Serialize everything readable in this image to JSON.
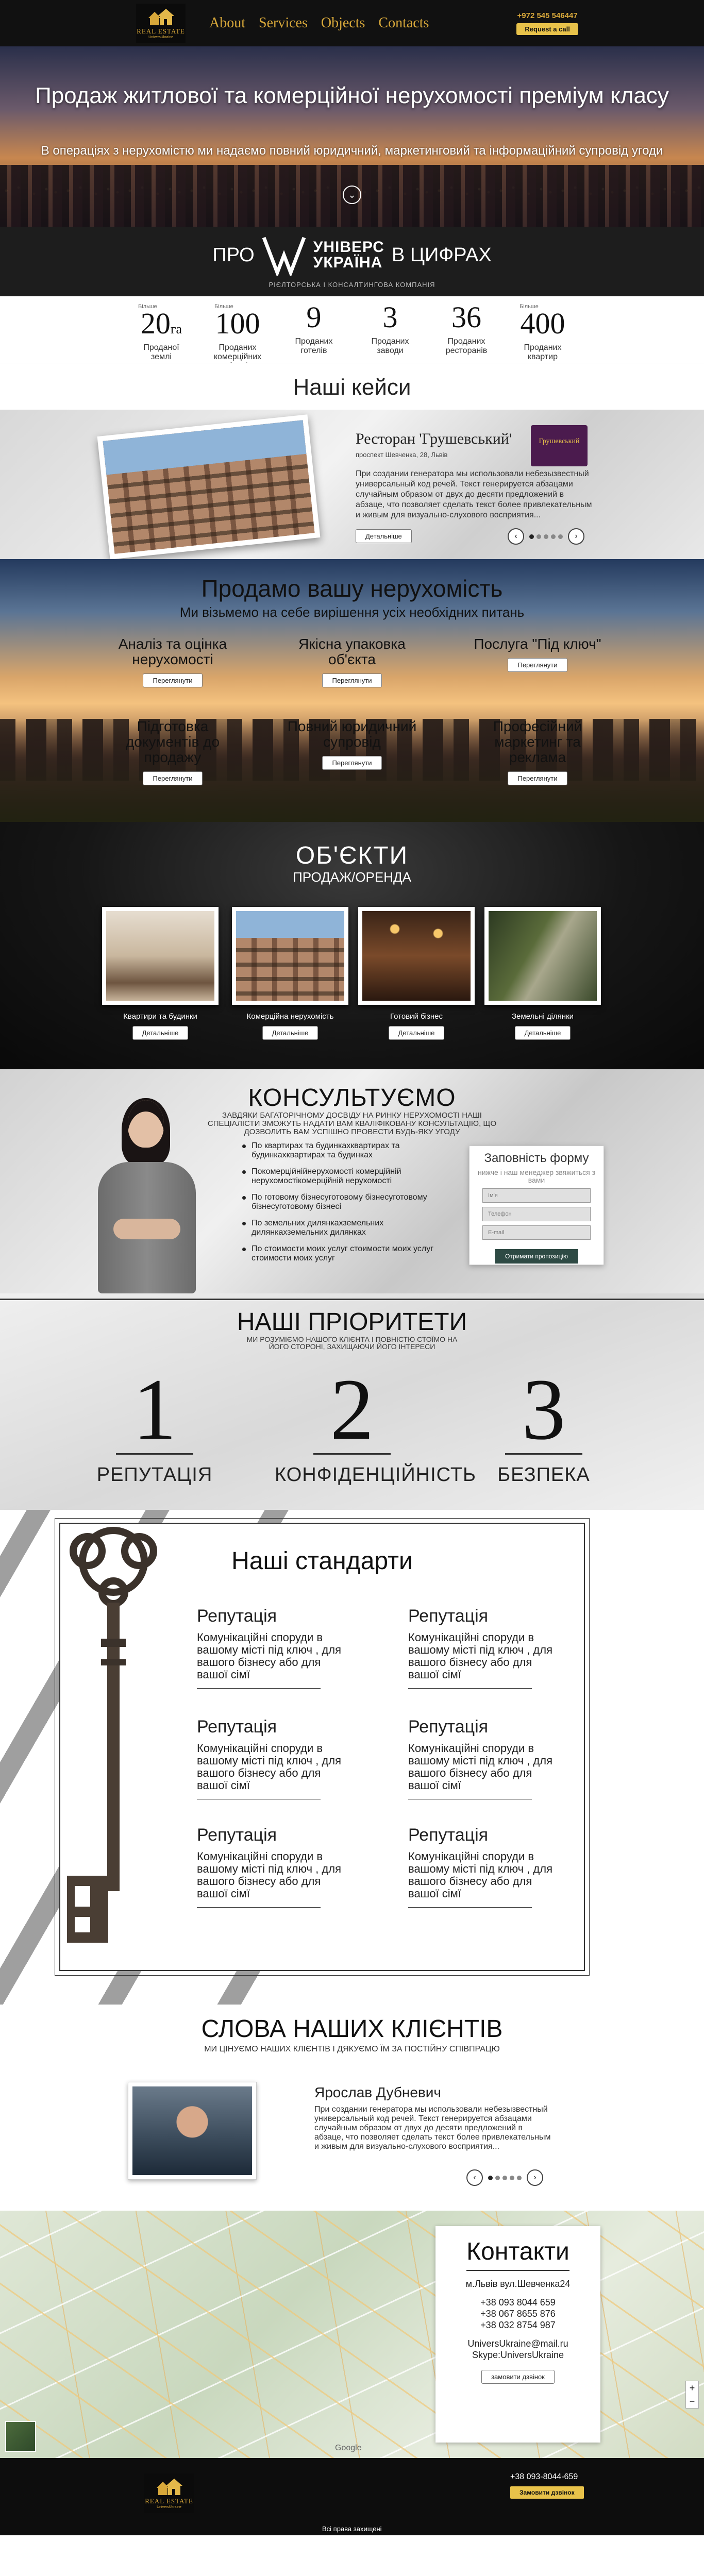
{
  "header": {
    "logo_title": "REAL ESTATE",
    "logo_sub": "UniversUkraine",
    "nav": [
      "About",
      "Services",
      "Objects",
      "Contacts"
    ],
    "phone": "+972 545 546447",
    "call_button": "Request a call"
  },
  "hero": {
    "title": "Продаж житлової та комерційної нерухомості преміум класу",
    "subtitle": "В операціях з нерухомістю ми надаємо повний юридичний, маркетинговий та інформаційний супровід угоди"
  },
  "about": {
    "pro": "ПРО",
    "brand_line1": "УНІВЕРС",
    "brand_line2": "УКРАЇНА",
    "in_numbers": "В ЦИФРАХ",
    "subtitle": "РІЄЛТОРСЬКА І КОНСАЛТИНГОВА КОМПАНІЯ"
  },
  "stats": [
    {
      "pre": "Більше",
      "value": "20",
      "unit": "га",
      "label": "Проданої землі"
    },
    {
      "pre": "Більше",
      "value": "100",
      "unit": "",
      "label": "Проданих комерційних об'єктів"
    },
    {
      "pre": "",
      "value": "9",
      "unit": "",
      "label": "Проданих готелів"
    },
    {
      "pre": "",
      "value": "3",
      "unit": "",
      "label": "Проданих заводи"
    },
    {
      "pre": "",
      "value": "36",
      "unit": "",
      "label": "Проданих ресторанів"
    },
    {
      "pre": "Більше",
      "value": "400",
      "unit": "",
      "label": "Проданих квартир"
    }
  ],
  "cases": {
    "section_title": "Наші кейси",
    "title": "Ресторан 'Грушевський'",
    "address": "проспект Шевченка, 28, Львів",
    "badge": "Грушевський",
    "text": "При создании генератора мы использовали небезызвестный универсальный код речей. Текст генерируется абзацами случайным образом от двух до десяти предложений в абзаце, что позволяет сделать текст более привлекательным и живым для визуально-слухового восприятия...",
    "button": "Детальніше",
    "prev": "‹",
    "next": "›"
  },
  "sell": {
    "title": "Продамо вашу нерухомість",
    "subtitle": "Ми візьмемо на себе вирішення усіх необхідних питань",
    "button": "Переглянути",
    "services": [
      "Аналіз та оцінка нерухомості",
      "Якісна упаковка об'єкта",
      "Послуга \"Під ключ\"",
      "Підготовка документів до продажу",
      "Повний юридичний супровід",
      "Професійний маркетинг та реклама"
    ]
  },
  "objects": {
    "title": "ОБ'ЄКТИ",
    "subtitle": "ПРОДАЖ/ОРЕНДА",
    "button": "Детальніше",
    "items": [
      "Квартири та будинки",
      "Комерційна нерухомість",
      "Готовий бізнес",
      "Земельні ділянки"
    ]
  },
  "consult": {
    "title": "КОНСУЛЬТУЄМО",
    "subtitle": "ЗАВДЯКИ БАГАТОРІЧНОМУ ДОСВІДУ НА РИНКУ НЕРУХОМОСТІ НАШІ СПЕЦІАЛІСТИ ЗМОЖУТЬ НАДАТИ ВАМ КВАЛІФІКОВАНУ КОНСУЛЬТАЦІЮ, ЩО ДОЗВОЛИТЬ ВАМ УСПІШНО ПРОВЕСТИ БУДЬ-ЯКУ УГОДУ",
    "items": [
      "По квартирах та будинкахквартирах та будинкахквартирах та будинках",
      "Покомерційнійнерухомості комерційній нерухомостікомерційній нерухомості",
      "По готовому бізнесуготовому бізнесуготовому бізнесуготовому бізнесі",
      "По земельних дилянкахземельних дилянкахземельних дилянках",
      "По стоимости моих услуг стоимости моих услуг стоимости моих услуг"
    ],
    "form": {
      "title": "Заповність форму",
      "subtitle": "нижче і наш менеджер звяжиться з вами",
      "name_placeholder": "Ім'я",
      "phone_placeholder": "Телефон",
      "email_placeholder": "E-mail",
      "button": "Отримати пропозицію"
    }
  },
  "priorities": {
    "title": "НАШІ ПРІОРИТЕТИ",
    "subtitle": "МИ РОЗУМІЄМО НАШОГО КЛІЄНТА І ПОВНІСТЮ СТОЇМО НА ЙОГО СТОРОНІ, ЗАХИЩАЮЧИ ЙОГО ІНТЕРЕСИ",
    "items": [
      {
        "num": "1",
        "label": "РЕПУТАЦІЯ"
      },
      {
        "num": "2",
        "label": "КОНФІДЕНЦІЙНІСТЬ"
      },
      {
        "num": "3",
        "label": "БЕЗПЕКА"
      }
    ]
  },
  "standards": {
    "title": "Наші стандарти",
    "items": [
      {
        "head": "Репутація",
        "body": "Комунікаційні споруди в вашому місті під ключ , для вашого бізнесу або для вашої сімї"
      },
      {
        "head": "Репутація",
        "body": "Комунікаційні споруди в вашому місті під ключ , для вашого бізнесу або для вашої сімї"
      },
      {
        "head": "Репутація",
        "body": "Комунікаційні споруди в вашому місті під ключ , для вашого бізнесу або для вашої сімї"
      },
      {
        "head": "Репутація",
        "body": "Комунікаційні споруди в вашому місті під ключ , для вашого бізнесу або для вашої сімї"
      },
      {
        "head": "Репутація",
        "body": "Комунікаційні споруди в вашому місті під ключ , для вашого бізнесу або для вашої сімї"
      },
      {
        "head": "Репутація",
        "body": "Комунікаційні споруди в вашому місті під ключ , для вашого бізнесу або для вашої сімї"
      }
    ]
  },
  "reviews": {
    "title": "СЛОВА НАШИХ КЛІЄНТІВ",
    "subtitle": "МИ ЦІНУЄМО НАШИХ КЛІЄНТІВ І ДЯКУЄМО ЇМ ЗА ПОСТІЙНУ СПІВПРАЦЮ",
    "name": "Ярослав Дубневич",
    "text": "При создании генератора мы использовали небезызвестный универсальный код речей. Текст генерируется абзацами случайным образом от двух до десяти предложений в абзаце, что позволяет сделать текст более привлекательным и живым для визуально-слухового восприятия...",
    "prev": "‹",
    "next": "›"
  },
  "contacts": {
    "title": "Контакти",
    "address": "м.Львів вул.Шевченка24",
    "phones": [
      "+38 093 8044 659",
      "+38 067 8655 876",
      "+38 032 8754 987"
    ],
    "email": "UniversUkraine@mail.ru",
    "skype": "Skype:UniversUkraine",
    "button": "замовити дзвінок",
    "map_brand": "Google",
    "zoom_in": "+",
    "zoom_out": "−"
  },
  "footer": {
    "phone": "+38 093-8044-659",
    "button": "Замовити дзвінок",
    "copyright": "Всі права захищені"
  },
  "colors": {
    "gold": "#d8a83a",
    "dark": "#111111",
    "form_button": "#2e4a44"
  }
}
